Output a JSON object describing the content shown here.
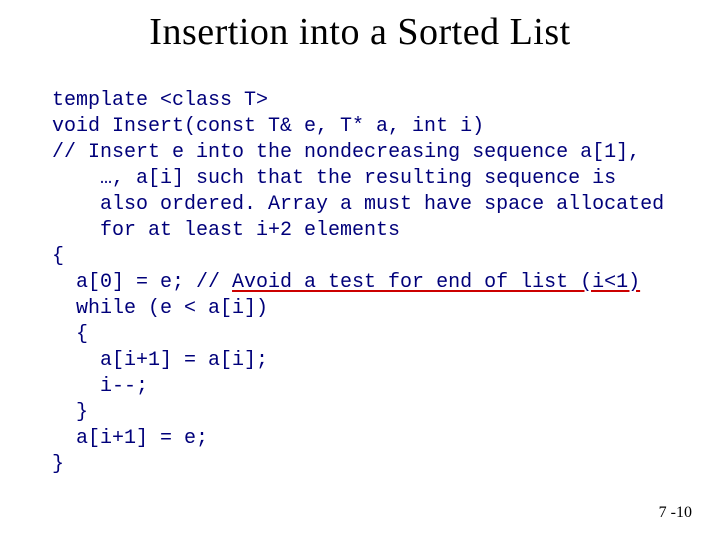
{
  "title": "Insertion into a Sorted List",
  "code": {
    "l1": "template <class T>",
    "l2": "void Insert(const T& e, T* a, int i)",
    "l3a": "// ",
    "l3b": "Insert e into the nondecreasing sequence a[1], …, a[i] such that the resulting sequence is also ordered. Array a must have space allocated for at least i+2 elements",
    "l4": "{",
    "l5a": "  a[0] = e; // ",
    "l5b": "Avoid a test for end of list (i<1)",
    "l6": "  while (e < a[i])",
    "l7": "  {",
    "l8": "    a[i+1] = a[i];",
    "l9": "    i--;",
    "l10": "  }",
    "l11": "  a[i+1] = e;",
    "l12": "}"
  },
  "pagenum": "7 -10"
}
